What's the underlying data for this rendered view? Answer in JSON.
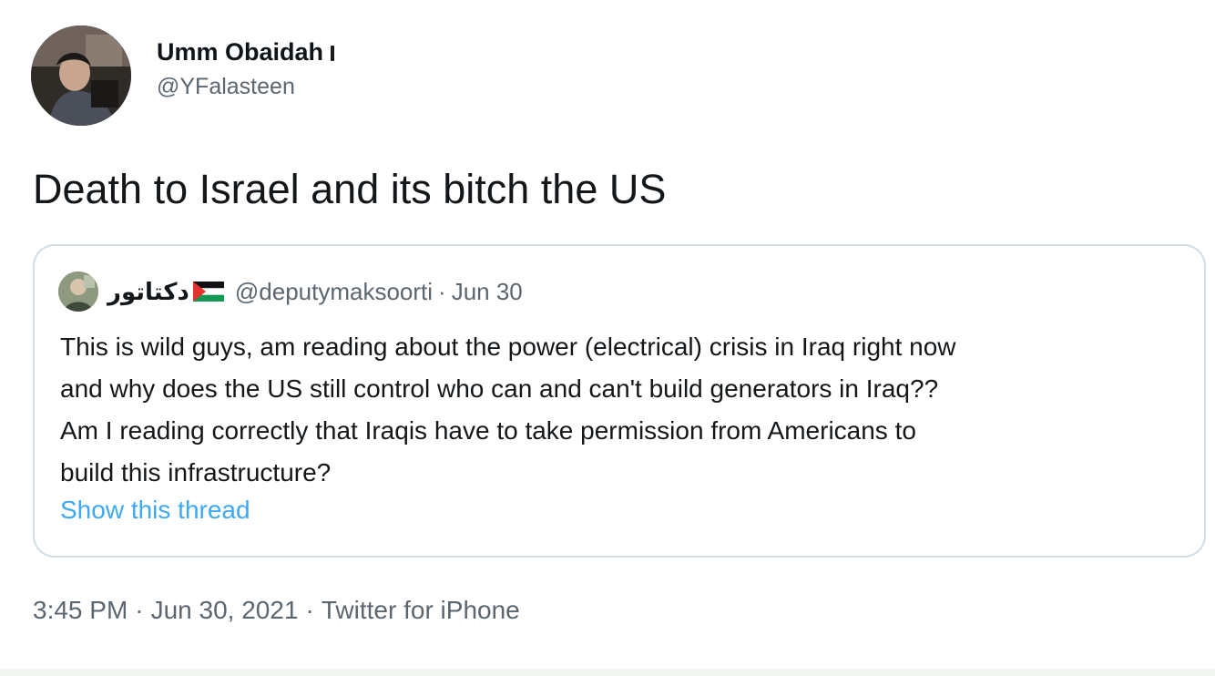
{
  "author": {
    "display_name": "Umm Obaidah",
    "handle": "@YFalasteen",
    "avatar_icon": "profile-photo-icon"
  },
  "tweet": {
    "text": "Death to Israel and its bitch the US"
  },
  "quoted_tweet": {
    "display_name": "دكتاتور",
    "flag_icon": "palestine-flag-icon",
    "handle": "@deputymaksoorti",
    "separator": "·",
    "date": "Jun 30",
    "lines": [
      "This is wild guys, am reading about the power (electrical) crisis in Iraq right now",
      "and why does the US still control who can and can't build generators in Iraq??",
      "Am I reading correctly that Iraqis have to take permission from Americans to",
      "build this infrastructure?"
    ],
    "show_thread_label": "Show this thread"
  },
  "footer": {
    "time": "3:45 PM",
    "date": "Jun 30, 2021",
    "source": "Twitter for iPhone",
    "separator": "·"
  },
  "colors": {
    "link": "#1d9bf0",
    "secondary_text": "#5b6670",
    "border": "#d5dde3"
  }
}
